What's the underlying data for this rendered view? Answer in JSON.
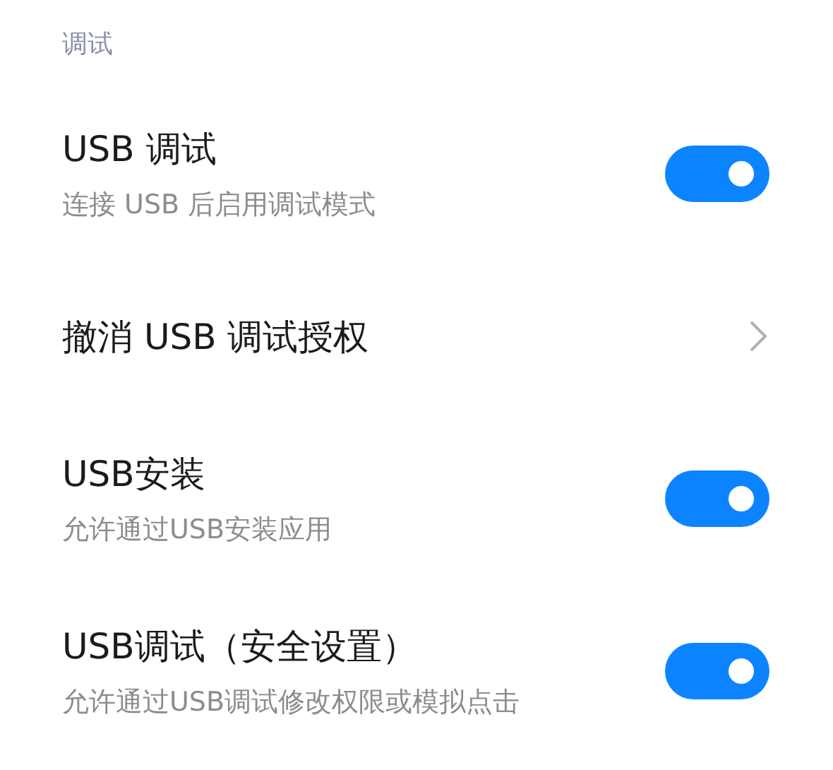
{
  "section": {
    "title": "调试"
  },
  "items": [
    {
      "kind": "toggle",
      "title": "USB 调试",
      "subtitle": "连接 USB 后启用调试模式",
      "on": true
    },
    {
      "kind": "link",
      "title": "撤消 USB 调试授权"
    },
    {
      "kind": "toggle",
      "title": "USB安装",
      "subtitle": "允许通过USB安装应用",
      "on": true
    },
    {
      "kind": "toggle",
      "title": "USB调试（安全设置）",
      "subtitle": "允许通过USB调试修改权限或模拟点击",
      "on": true
    }
  ]
}
